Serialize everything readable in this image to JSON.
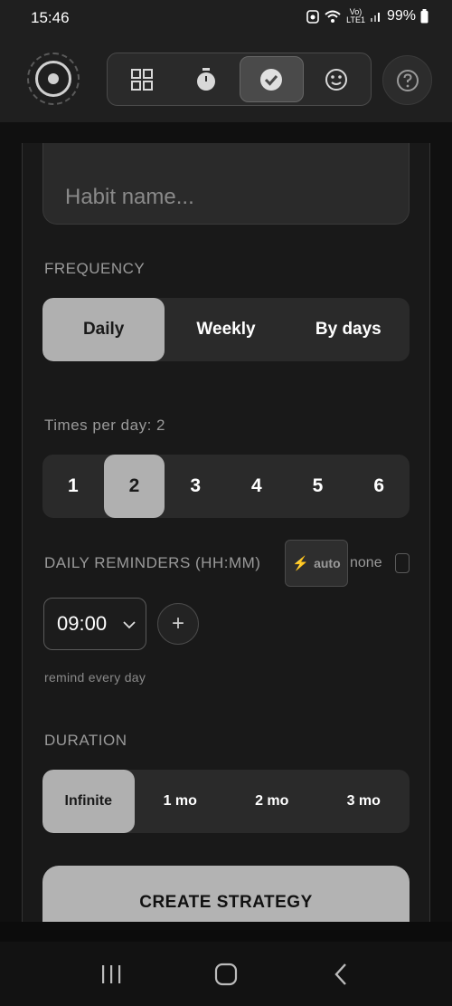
{
  "status": {
    "time": "15:46",
    "battery": "99%",
    "network_top": "Vo)",
    "network_bottom": "LTE1"
  },
  "nav_tabs": [
    {
      "icon": "grid-icon",
      "active": false
    },
    {
      "icon": "stopwatch-icon",
      "active": false
    },
    {
      "icon": "check-circle-icon",
      "active": true
    },
    {
      "icon": "smiley-icon",
      "active": false
    }
  ],
  "form": {
    "name_placeholder": "Habit name...",
    "frequency_label": "FREQUENCY",
    "frequency_options": [
      "Daily",
      "Weekly",
      "By days"
    ],
    "frequency_selected": "Daily",
    "times_label": "Times per day: 2",
    "times_options": [
      "1",
      "2",
      "3",
      "4",
      "5",
      "6"
    ],
    "times_selected": "2",
    "reminders_label": "DAILY REMINDERS (HH:MM)",
    "auto_label": "auto",
    "none_label": "none",
    "reminder_time": "09:00",
    "add_label": "+",
    "remind_hint": "remind every day",
    "duration_label": "DURATION",
    "duration_options": [
      "Infinite",
      "1 mo",
      "2 mo",
      "3 mo"
    ],
    "duration_selected": "Infinite",
    "create_label": "CREATE STRATEGY"
  },
  "colors": {
    "background": "#101010",
    "surface": "#2a2a2a",
    "selected": "#b0b0b0",
    "accent_bolt": "#e8b84a"
  }
}
